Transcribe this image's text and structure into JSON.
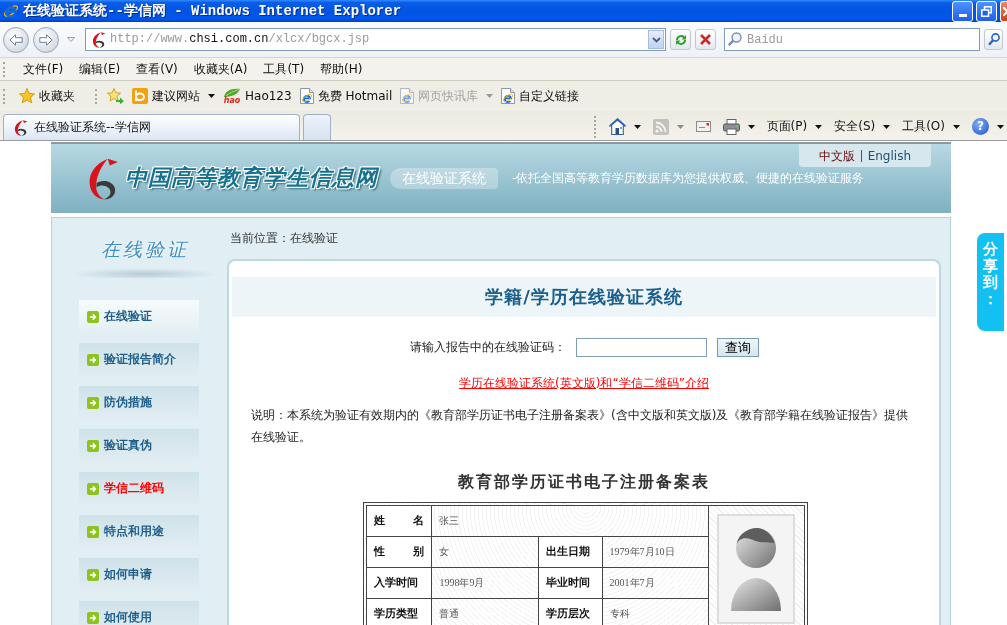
{
  "window": {
    "title": "在线验证系统--学信网 - Windows Internet Explorer"
  },
  "address_bar": {
    "url": "http://www.**chsi.com.cn**/xlcx/bgcx.jsp"
  },
  "search": {
    "placeholder": "Baidu"
  },
  "menu": [
    {
      "label": "文件(F)"
    },
    {
      "label": "编辑(E)"
    },
    {
      "label": "查看(V)"
    },
    {
      "label": "收藏夹(A)"
    },
    {
      "label": "工具(T)"
    },
    {
      "label": "帮助(H)"
    }
  ],
  "favorites_bar": {
    "favorites_label": "收藏夹",
    "links": [
      {
        "kind": "ring",
        "label": "建议网站",
        "dropdown": true,
        "disabled": false
      },
      {
        "kind": "leaf",
        "logo_text": "hao",
        "label": "Hao123",
        "dropdown": false,
        "disabled": false
      },
      {
        "kind": "page",
        "label": "免费 Hotmail",
        "dropdown": false,
        "disabled": false
      },
      {
        "kind": "page",
        "label": "网页快讯库",
        "dropdown": true,
        "disabled": true
      },
      {
        "kind": "page",
        "label": "自定义链接",
        "dropdown": false,
        "disabled": false
      }
    ]
  },
  "tabs": [
    {
      "label": "在线验证系统--学信网",
      "selected": true
    }
  ],
  "command_bar": [
    {
      "kind": "home",
      "dropdown": true,
      "disabled": false
    },
    {
      "kind": "feed",
      "dropdown": true,
      "disabled": true
    },
    {
      "kind": "mail",
      "dropdown": false,
      "disabled": false
    },
    {
      "kind": "print",
      "dropdown": true,
      "disabled": false
    },
    {
      "kind": "text",
      "label": "页面(P)",
      "dropdown": true,
      "disabled": false
    },
    {
      "kind": "text",
      "label": "安全(S)",
      "dropdown": true,
      "disabled": false
    },
    {
      "kind": "text",
      "label": "工具(O)",
      "dropdown": true,
      "disabled": false
    },
    {
      "kind": "help",
      "label": "?",
      "dropdown": true,
      "disabled": false
    }
  ],
  "site_header": {
    "logo_text": "中国高等教育学生信息网",
    "system_name": "在线验证系统",
    "slogan": "-依托全国高等教育学历数据库为您提供权威、便捷的在线验证服务",
    "languages": [
      {
        "label": "中文版",
        "selected": true
      },
      {
        "label": "English",
        "selected": false
      }
    ]
  },
  "sidebar": {
    "title": "在线验证",
    "items": [
      {
        "label": "在线验证",
        "selected": true,
        "highlight": false
      },
      {
        "label": "验证报告简介",
        "selected": false,
        "highlight": false
      },
      {
        "label": "防伪措施",
        "selected": false,
        "highlight": false
      },
      {
        "label": "验证真伪",
        "selected": false,
        "highlight": false
      },
      {
        "label": "学信二维码",
        "selected": false,
        "highlight": true
      },
      {
        "label": "特点和用途",
        "selected": false,
        "highlight": false
      },
      {
        "label": "如何申请",
        "selected": false,
        "highlight": false
      },
      {
        "label": "如何使用",
        "selected": false,
        "highlight": false
      }
    ]
  },
  "breadcrumb": "当前位置：在线验证",
  "verify_panel": {
    "title": "学籍/学历在线验证系统",
    "code_label": "请输入报告中的在线验证码：",
    "query_button": "查询",
    "intro_link": "学历在线验证系统(英文版)和“学信二维码”介绍",
    "note": "说明：本系统为验证有效期内的《教育部学历证书电子注册备案表》(含中文版和英文版)及《教育部学籍在线验证报告》提供在线验证。"
  },
  "certificate": {
    "title": "教育部学历证书电子注册备案表",
    "rows": [
      {
        "fields": [
          {
            "label": "姓 名",
            "value": "张三"
          }
        ]
      },
      {
        "fields": [
          {
            "label": "性 别",
            "value": "女"
          },
          {
            "label": "出生日期",
            "value": "1979年7月10日"
          }
        ]
      },
      {
        "fields": [
          {
            "label": "入学时间",
            "value": "1998年9月"
          },
          {
            "label": "毕业时间",
            "value": "2001年7月"
          }
        ]
      },
      {
        "fields": [
          {
            "label": "学历类型",
            "value": "普通"
          },
          {
            "label": "学历层次",
            "value": "专科"
          }
        ]
      }
    ]
  },
  "share_tab": {
    "label": "分享到："
  }
}
